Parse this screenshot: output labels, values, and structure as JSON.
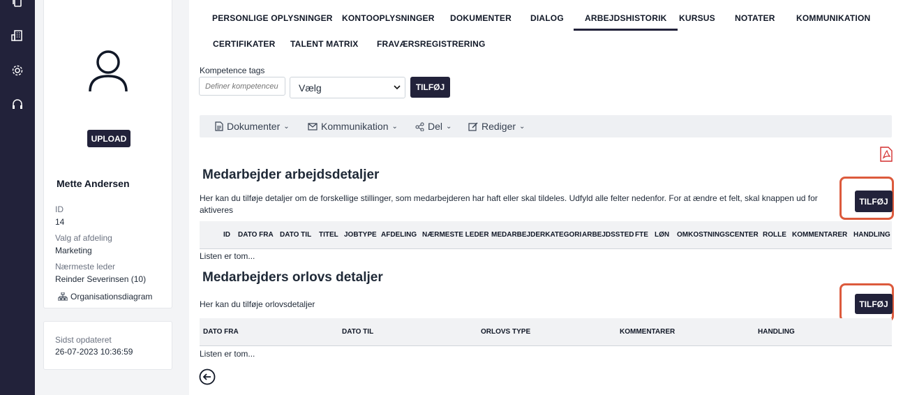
{
  "rail": {
    "icons": [
      "copy-icon",
      "building-icon",
      "gear-icon",
      "headset-icon"
    ]
  },
  "profile": {
    "upload_label": "UPLOAD",
    "name": "Mette Andersen",
    "id_label": "ID",
    "id_value": "14",
    "dept_label": "Valg af afdeling",
    "dept_value": "Marketing",
    "manager_label": "Nærmeste leder",
    "manager_value": "Reinder Severinsen (10)",
    "org_link": "Organisationsdiagram",
    "updated_label": "Sidst opdateret",
    "updated_value": "26-07-2023 10:36:59"
  },
  "tabs": [
    "PERSONLIGE OPLYSNINGER",
    "KONTOOPLYSNINGER",
    "DOKUMENTER",
    "DIALOG",
    "ARBEJDSHISTORIK",
    "KURSUS",
    "NOTATER",
    "KOMMUNIKATION",
    "CERTIFIKATER",
    "TALENT MATRIX",
    "FRAVÆRSREGISTRERING"
  ],
  "active_tab": "ARBEJDSHISTORIK",
  "competence": {
    "label": "Kompetence tags",
    "placeholder": "Definer kompetenceu",
    "select_value": "Vælg",
    "add_label": "TILFØJ"
  },
  "toolbar": {
    "documents": "Dokumenter",
    "communication": "Kommunikation",
    "share": "Del",
    "edit": "Rediger"
  },
  "work": {
    "title": "Medarbejder arbejdsdetaljer",
    "desc1": "Her kan du tilføje detaljer om de forskellige stillinger, som medarbejderen har haft eller skal tildeles. Udfyld alle felter nedenfor. For at ændre et felt, skal knappen ud for",
    "desc2": "aktiveres",
    "add_label": "TILFØJ",
    "columns": [
      "ID",
      "DATO FRA",
      "DATO TIL",
      "TITEL",
      "JOBTYPE",
      "AFDELING",
      "NÆRMESTE LEDER",
      "MEDARBEJDERKATEGORI",
      "ARBEJDSSTED",
      "FTE",
      "LØN",
      "OMKOSTNINGSCENTER",
      "ROLLE",
      "KOMMENTARER",
      "HANDLING"
    ],
    "empty": "Listen er tom..."
  },
  "leave": {
    "title": "Medarbejders orlovs detaljer",
    "desc": "Her kan du tilføje orlovsdetaljer",
    "add_label": "TILFØJ",
    "columns": [
      "DATO FRA",
      "DATO TIL",
      "ORLOVS TYPE",
      "KOMMENTARER",
      "HANDLING"
    ],
    "empty": "Listen er tom..."
  },
  "colors": {
    "dark": "#22223a",
    "highlight": "#dc5a3c"
  }
}
